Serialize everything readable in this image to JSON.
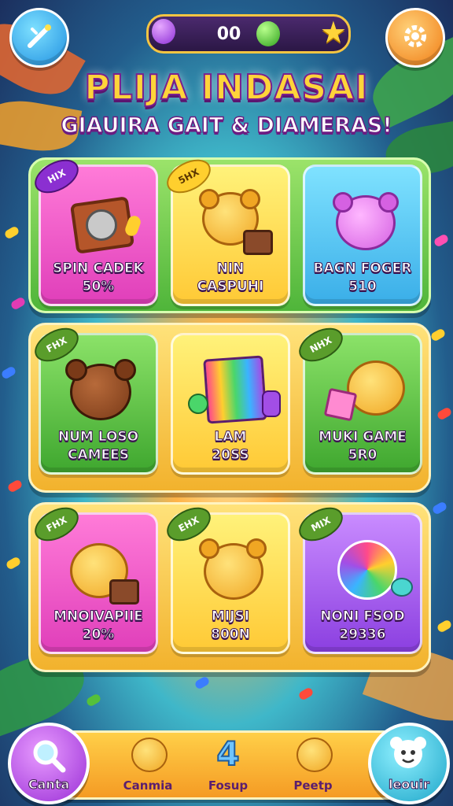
{
  "header": {
    "score": "00",
    "title": "PLIJA INDASAI",
    "subtitle": "GIAUIRA GAIT & DIAMERAS!"
  },
  "rows": [
    {
      "cards": [
        {
          "tag": "HIX",
          "label_1": "SPIN CADEK",
          "label_2": "50%"
        },
        {
          "tag": "5HX",
          "label_1": "NIN",
          "label_2": "CASPUHI"
        },
        {
          "tag": "",
          "label_1": "BAGN FOGER",
          "label_2": "510"
        }
      ]
    },
    {
      "cards": [
        {
          "tag": "FHX",
          "label_1": "NUM LOSO",
          "label_2": "CAMEES"
        },
        {
          "tag": "",
          "label_1": "LAM",
          "label_2": "20SS"
        },
        {
          "tag": "NHX",
          "label_1": "MUKI GAME",
          "label_2": "5R0"
        }
      ]
    },
    {
      "cards": [
        {
          "tag": "FHX",
          "label_1": "MNOIVAPIIE",
          "label_2": "20%"
        },
        {
          "tag": "EHX",
          "label_1": "MIJSI",
          "label_2": "800N"
        },
        {
          "tag": "MIX",
          "label_1": "NONI FSOD",
          "label_2": "29336"
        }
      ]
    }
  ],
  "nav": {
    "left_button": "Canta",
    "item_1": "Canmia",
    "item_2": "Fosup",
    "item_3": "Peetp",
    "right_button": "leouir"
  },
  "icons": {
    "top_left": "wand-icon",
    "top_right": "gear-icon",
    "search": "magnifier-icon"
  },
  "colors": {
    "card_pink": "#f04fc0",
    "card_yellow": "#ffd84a",
    "card_blue": "#4fc6f0",
    "card_green": "#52c24a",
    "card_purple": "#a24ee6"
  }
}
